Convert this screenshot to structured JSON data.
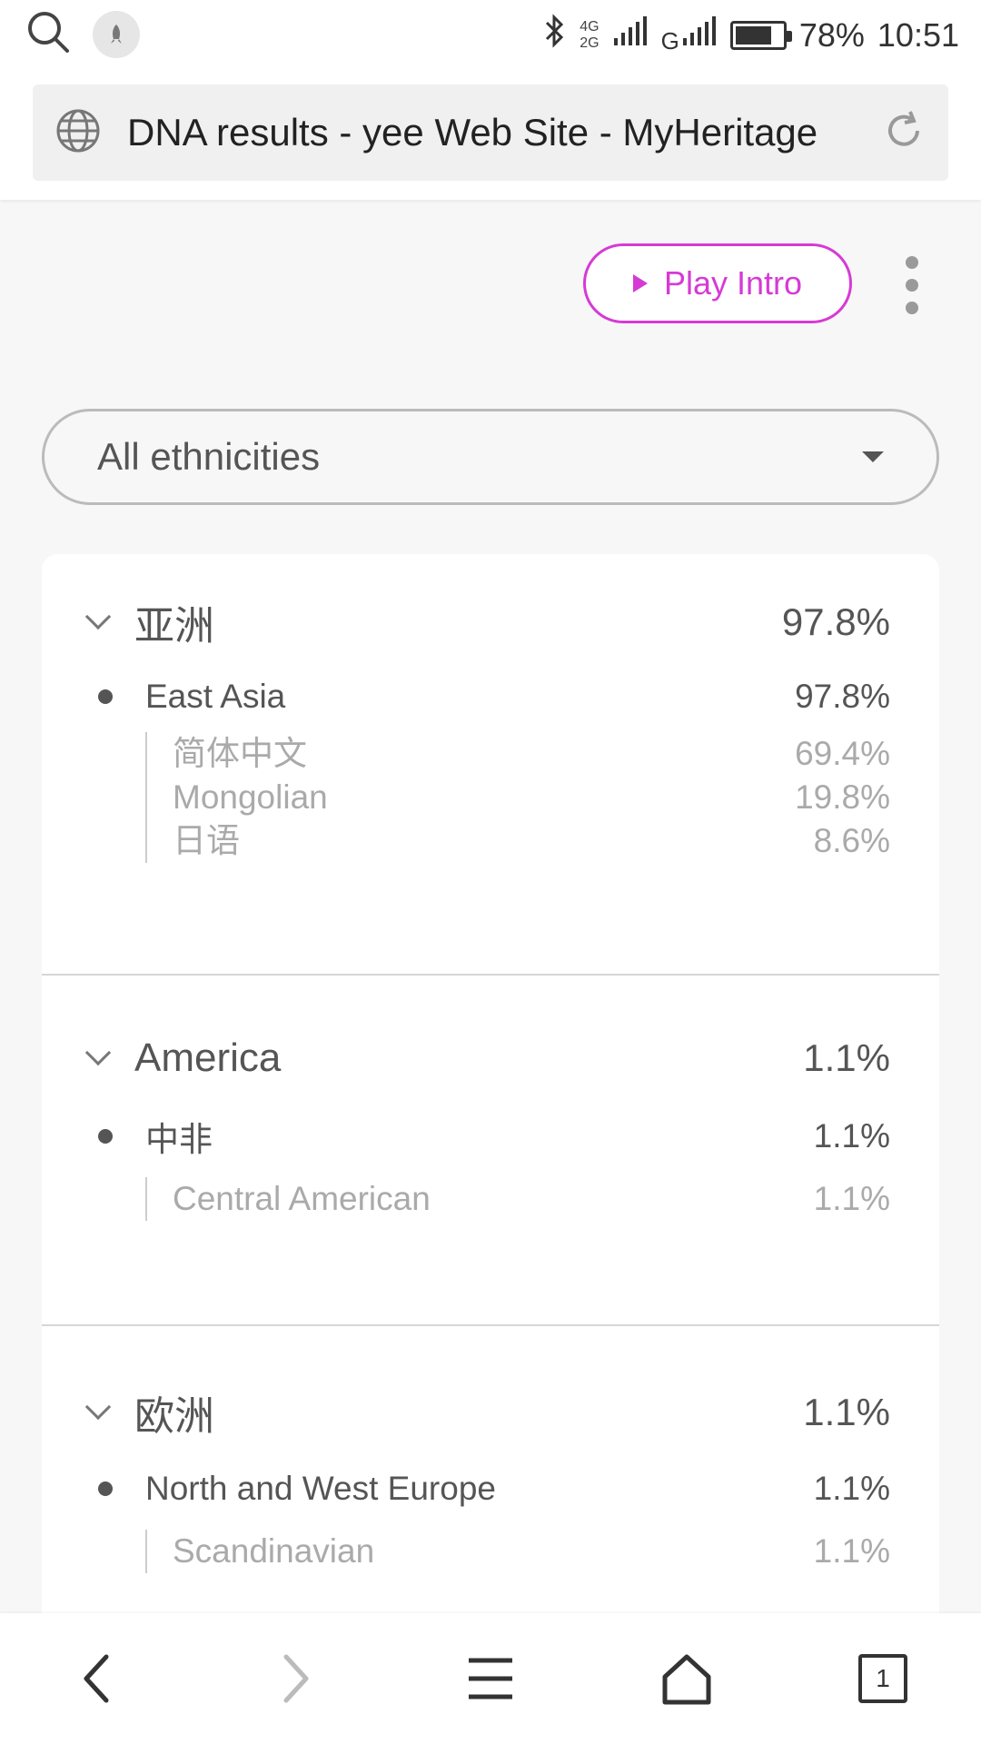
{
  "status_bar": {
    "network_top": "4G",
    "network_bottom": "2G",
    "carrier_mark": "G",
    "battery": "78%",
    "time": "10:51",
    "battery_level": 0.78
  },
  "browser": {
    "url_title": "DNA results - yee Web Site - MyHeritage"
  },
  "page": {
    "play_intro_label": "Play Intro",
    "filter_selected": "All ethnicities"
  },
  "regions": [
    {
      "name": "亚洲",
      "pct": "97.8%",
      "sub": {
        "name": "East Asia",
        "pct": "97.8%",
        "details": [
          {
            "name": "简体中文",
            "pct": "69.4%"
          },
          {
            "name": "Mongolian",
            "pct": "19.8%"
          },
          {
            "name": "日语",
            "pct": "8.6%"
          }
        ]
      }
    },
    {
      "name": "America",
      "pct": "1.1%",
      "sub": {
        "name": "中非",
        "pct": "1.1%",
        "details": [
          {
            "name": "Central American",
            "pct": "1.1%"
          }
        ]
      }
    },
    {
      "name": "欧洲",
      "pct": "1.1%",
      "sub": {
        "name": "North and West Europe",
        "pct": "1.1%",
        "details": [
          {
            "name": "Scandinavian",
            "pct": "1.1%"
          }
        ]
      }
    }
  ],
  "nav": {
    "tab_count": "1"
  }
}
